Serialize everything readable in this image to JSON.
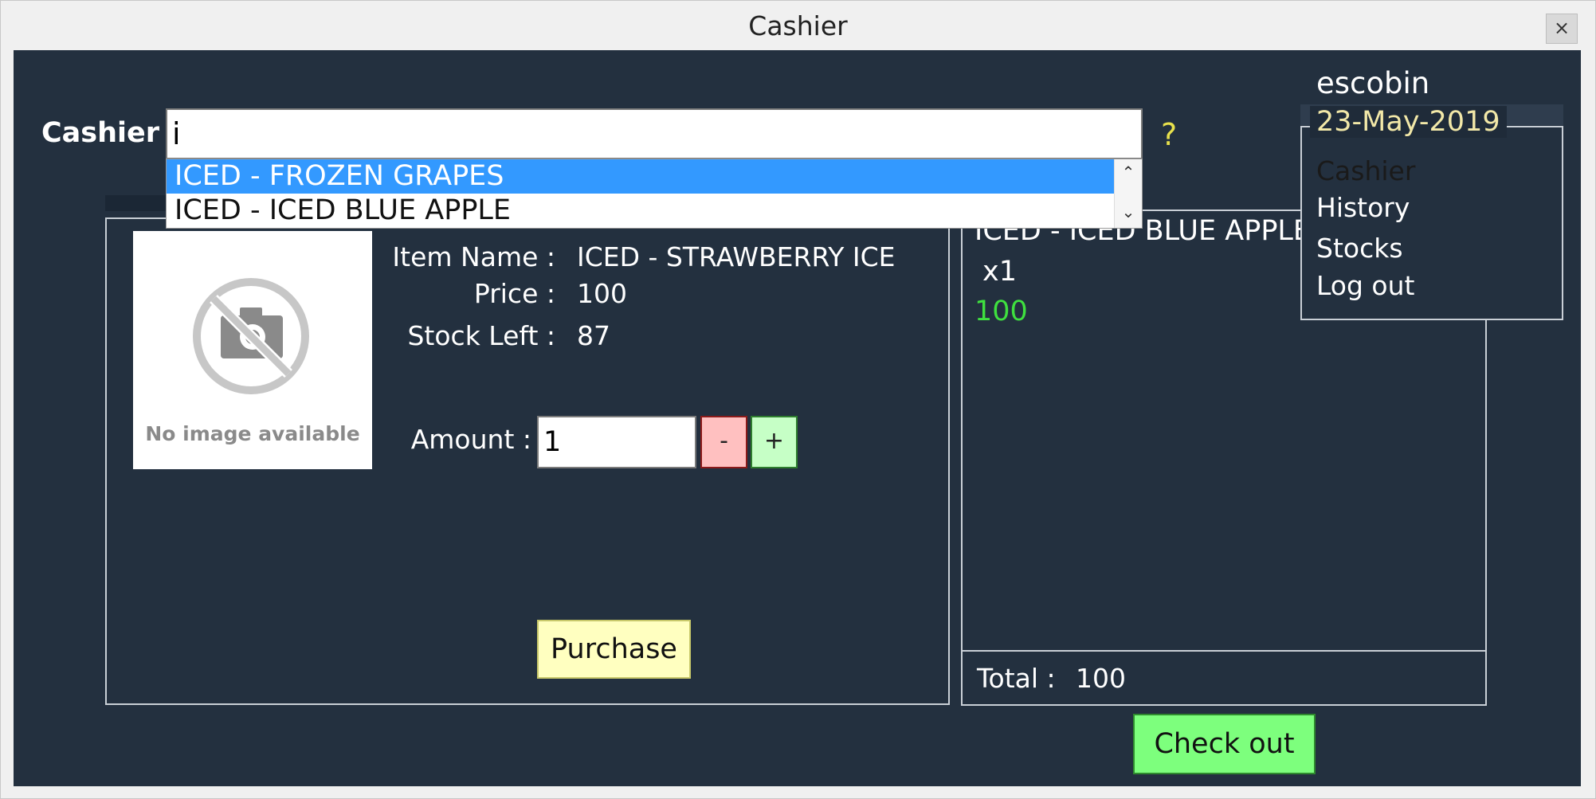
{
  "window": {
    "title": "Cashier",
    "close_label": "×"
  },
  "search": {
    "label": "Cashier",
    "value": "i",
    "help": "?"
  },
  "suggestions": [
    {
      "label": "ICED - FROZEN GRAPES",
      "selected": true
    },
    {
      "label": "ICED - ICED BLUE APPLE",
      "selected": false
    }
  ],
  "product": {
    "image_placeholder": "No image available",
    "item_name_label": "Item Name :",
    "item_name_value": "ICED - STRAWBERRY ICE",
    "price_label": "Price :",
    "price_value": "100",
    "stock_label": "Stock Left :",
    "stock_value": "87",
    "amount_label": "Amount :",
    "amount_value": "1",
    "minus_label": "-",
    "plus_label": "+",
    "purchase_label": "Purchase"
  },
  "cart": {
    "items": [
      {
        "name": "ICED - ICED BLUE APPLE",
        "qty": "x1",
        "price": "100"
      }
    ],
    "total_label": "Total :",
    "total_value": "100",
    "checkout_label": "Check out"
  },
  "user": {
    "name": "escobin",
    "date": "23-May-2019",
    "menu": [
      "Cashier",
      "History",
      "Stocks",
      "Log out"
    ]
  },
  "colors": {
    "background": "#23303f",
    "selection": "#3399ff",
    "price_green": "#3fe03f",
    "date_text": "#f2e8a8",
    "help_yellow": "#e8e14c"
  }
}
